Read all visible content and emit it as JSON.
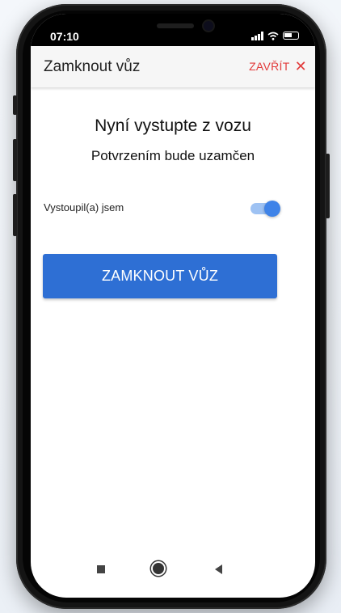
{
  "status_bar": {
    "time": "07:10"
  },
  "app_bar": {
    "title": "Zamknout vůz",
    "close_label": "ZAVŘÍT",
    "close_icon": "✕"
  },
  "content": {
    "heading": "Nyní vystupte z vozu",
    "subheading": "Potvrzením bude uzamčen",
    "toggle_label": "Vystoupil(a) jsem",
    "toggle_on": true,
    "lock_button_label": "ZAMKNOUT VŮZ"
  },
  "colors": {
    "accent": "#2e6fd4",
    "close_red": "#e23b3b",
    "toggle_track": "#9ec2f3",
    "toggle_knob": "#3f83e8"
  },
  "icons": [
    "signal-icon",
    "wifi-icon",
    "battery-icon",
    "close-icon",
    "nav-recent-icon",
    "nav-home-icon",
    "nav-back-icon"
  ]
}
